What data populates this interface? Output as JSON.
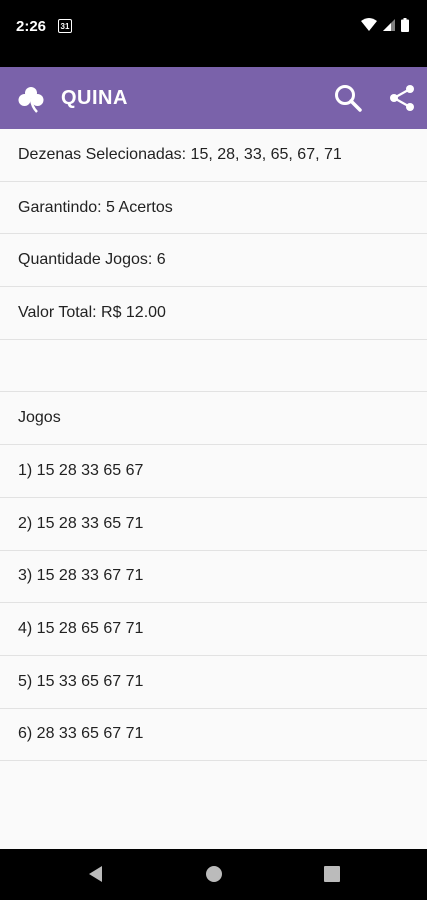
{
  "status_bar": {
    "time": "2:26",
    "calendar_day": "31"
  },
  "app_bar": {
    "title": "QUINA",
    "logo_icon": "clover-icon",
    "actions": [
      "search-icon",
      "share-icon"
    ],
    "color": "#7a62aa"
  },
  "summary": {
    "dezenas": "Dezenas Selecionadas: 15, 28, 33, 65, 67, 71",
    "garantindo": "Garantindo: 5 Acertos",
    "quantidade": "Quantidade Jogos: 6",
    "valor": "Valor Total: R$ 12.00"
  },
  "jogos": {
    "header": "Jogos",
    "items": [
      "1) 15 28 33 65 67",
      "2) 15 28 33 65 71",
      "3) 15 28 33 67 71",
      "4) 15 28 65 67 71",
      "5) 15 33 65 67 71",
      "6) 28 33 65 67 71"
    ]
  },
  "nav_bar": {
    "buttons": [
      "back-icon",
      "home-icon",
      "recents-icon"
    ]
  }
}
